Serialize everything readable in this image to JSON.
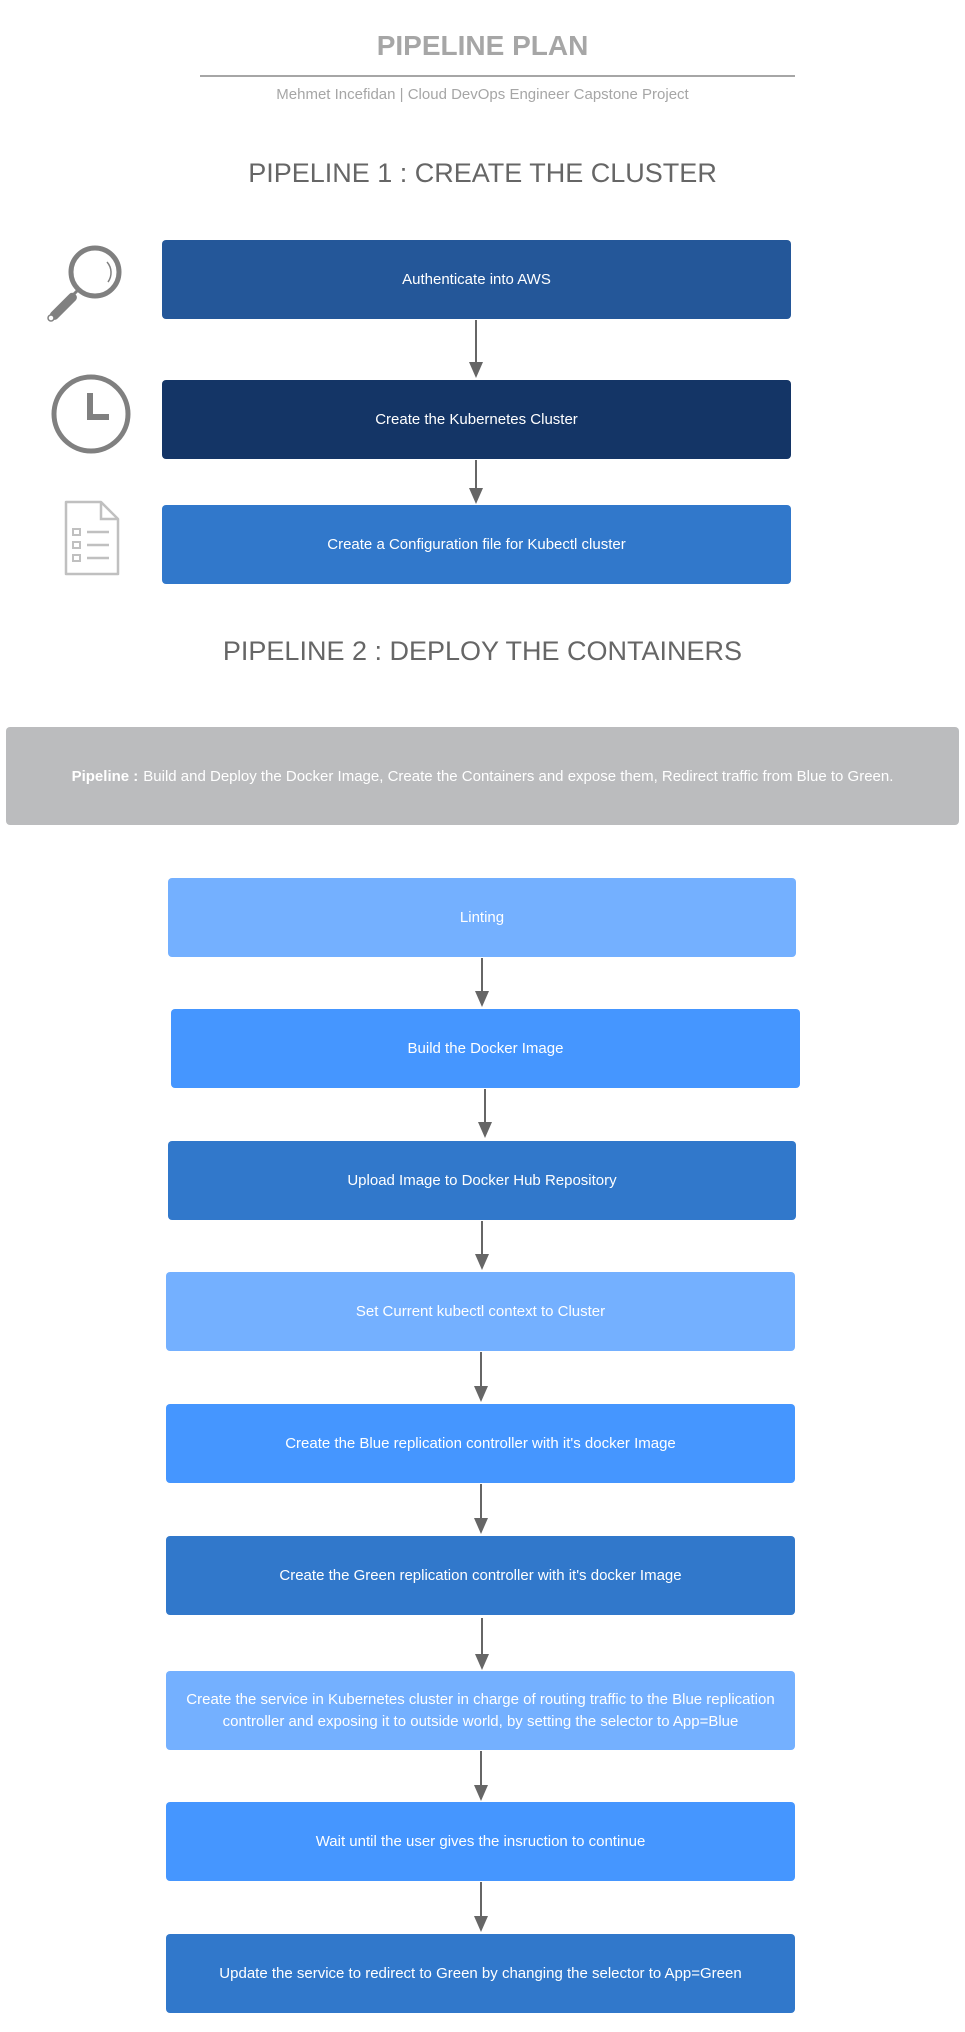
{
  "header": {
    "title": "PIPELINE PLAN",
    "subtitle": "Mehmet Incefidan  | Cloud DevOps Engineer Capstone Project"
  },
  "pipeline1": {
    "heading": "PIPELINE 1 : CREATE THE  CLUSTER",
    "steps": [
      {
        "label": "Authenticate into AWS",
        "icon": "magnifier-icon",
        "color": "#245799"
      },
      {
        "label": "Create the Kubernetes Cluster",
        "icon": "clock-icon",
        "color": "#143566"
      },
      {
        "label": "Create a Configuration file for Kubectl cluster",
        "icon": "document-checklist-icon",
        "color": "#3178cb"
      }
    ]
  },
  "pipeline2": {
    "heading": "PIPELINE 2 : DEPLOY THE  CONTAINERS",
    "banner": {
      "bold": "Pipeline :",
      "text": "Build and Deploy the Docker Image, Create the Containers and expose them, Redirect traffic from Blue to Green."
    },
    "steps": [
      {
        "label": "Linting",
        "color": "#74b0ff"
      },
      {
        "label": "Build the Docker Image",
        "color": "#4596ff"
      },
      {
        "label": "Upload Image to Docker Hub Repository",
        "color": "#3178cb"
      },
      {
        "label": "Set Current kubectl context to Cluster",
        "color": "#74b0ff"
      },
      {
        "label": "Create the Blue replication controller with it's docker Image",
        "color": "#4596ff"
      },
      {
        "label": "Create the Green replication controller with it's docker Image",
        "color": "#3178cb"
      },
      {
        "label": "Create the service in Kubernetes cluster in charge of routing traffic to the Blue replication controller and exposing it to outside world, by setting the selector to App=Blue",
        "color": "#74b0ff"
      },
      {
        "label": "Wait until the user gives the insruction to continue",
        "color": "#4596ff"
      },
      {
        "label": "Update the service to redirect to Green by changing the selector to App=Green",
        "color": "#3178cb"
      }
    ]
  }
}
